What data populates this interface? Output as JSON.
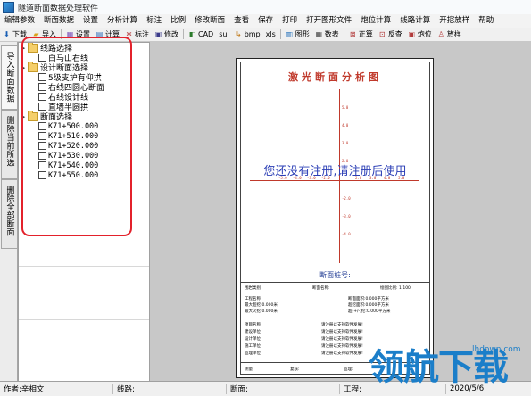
{
  "window": {
    "title": "隧道断面数据处理软件"
  },
  "menu": [
    "编辑参数",
    "断面数据",
    "设置",
    "分析计算",
    "标注",
    "比例",
    "修改断面",
    "查看",
    "保存",
    "打印",
    "打开图形文件",
    "炮位计算",
    "线路计算",
    "开挖放样",
    "帮助"
  ],
  "toolbar": [
    {
      "icon": "download-icon",
      "label": "下载"
    },
    {
      "icon": "import-icon",
      "label": "导入"
    },
    {
      "icon": "settings-icon",
      "label": "设置"
    },
    {
      "icon": "calculate-icon",
      "label": "计算"
    },
    {
      "icon": "annotate-icon",
      "label": "标注"
    },
    {
      "icon": "modify-icon",
      "label": "修改"
    },
    {
      "icon": "cad-icon",
      "label": "CAD"
    },
    {
      "icon": "sui-icon",
      "label": "sui"
    },
    {
      "icon": "bmp-icon",
      "label": "bmp"
    },
    {
      "icon": "xls-icon",
      "label": "xls"
    },
    {
      "icon": "graphic-icon",
      "label": "图形"
    },
    {
      "icon": "table-icon",
      "label": "数表"
    },
    {
      "icon": "front-view-icon",
      "label": "正算"
    },
    {
      "icon": "back-view-icon",
      "label": "反查"
    },
    {
      "icon": "blast-position-icon",
      "label": "炮位"
    },
    {
      "icon": "stakeout-icon",
      "label": "放样"
    }
  ],
  "side_tabs": [
    "导入断面数据",
    "删除当前所选",
    "删除全部断面"
  ],
  "tree": {
    "route_group": "线路选择",
    "route_items": [
      "白马山右线"
    ],
    "design_group": "设计断面选择",
    "design_items": [
      "5级支护有仰拱",
      "右线四圆心断面",
      "右线设计线",
      "直墙半圆拱"
    ],
    "section_group": "断面选择",
    "section_items": [
      "K71+500.000",
      "K71+510.000",
      "K71+520.000",
      "K71+530.000",
      "K71+540.000",
      "K71+550.000"
    ]
  },
  "paper": {
    "title": "激光断面分析图",
    "watermark": "您还没有注册,请注册后使用",
    "section_no_label": "断面桩号:",
    "ticks": {
      "top1": "5.0",
      "top2": "4.0",
      "top3": "3.0",
      "top4": "2.0",
      "left1": "-5.0",
      "left2": "-4.0",
      "left3": "-3.0",
      "left4": "-2.0",
      "right1": "2.0",
      "right2": "3.0",
      "right3": "4.0",
      "right4": "5.0",
      "bottom1": "-2.0",
      "bottom2": "-3.0",
      "bottom3": "-4.0"
    },
    "info_row": {
      "type": "围岩类别:",
      "name": "断面名称:",
      "scale": "绘图比例: 1:100"
    },
    "metrics_left": [
      "工程名称:",
      "最大超挖:0.000米",
      "最大欠挖:0.000米"
    ],
    "metrics_right": [
      "断面面积:0.000平方米",
      "超挖面积:0.000平方米",
      "超(+/-)挖:0.000平方米"
    ],
    "project_labels": [
      "项目名称:",
      "建设单位:",
      "设计单位:",
      "施工单位:",
      "监理单位:"
    ],
    "register_note": "请注册以支持软件发展!",
    "footer": {
      "survey": "测量:",
      "review": "复核:",
      "audit": "监理:"
    }
  },
  "status": {
    "author": "作者:辛相文",
    "route": "线路:",
    "section": "断面:",
    "project": "工程:",
    "date": "2020/5/6"
  },
  "brand": {
    "logo_text": "领航下载",
    "logo_url": "lhdown.com"
  }
}
